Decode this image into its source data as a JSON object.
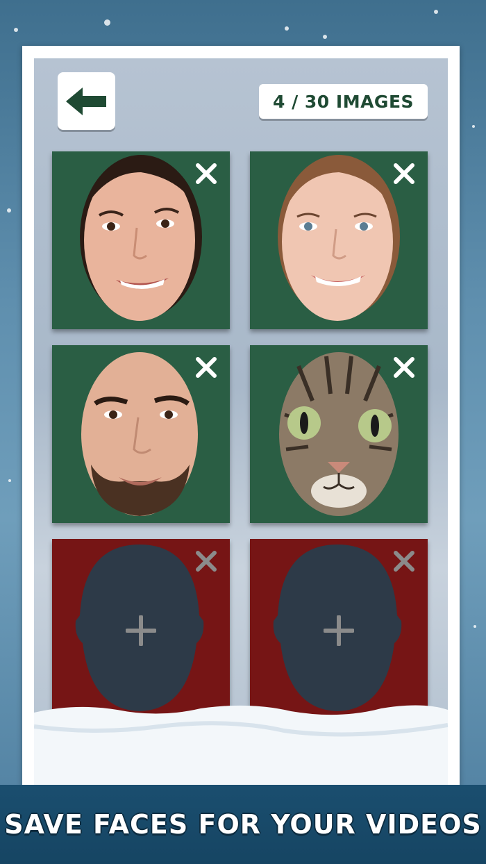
{
  "header": {
    "back_icon": "arrow-left-icon",
    "counter_text": "4 / 30 IMAGES"
  },
  "faces": [
    {
      "state": "filled",
      "kind": "woman-dark-hair",
      "icon": "close-icon"
    },
    {
      "state": "filled",
      "kind": "woman-auburn-hair",
      "icon": "close-icon"
    },
    {
      "state": "filled",
      "kind": "man-beard",
      "icon": "close-icon"
    },
    {
      "state": "filled",
      "kind": "cat",
      "icon": "close-icon"
    },
    {
      "state": "empty",
      "kind": "placeholder",
      "icon": "close-icon",
      "add_icon": "plus-icon"
    },
    {
      "state": "empty",
      "kind": "placeholder",
      "icon": "close-icon",
      "add_icon": "plus-icon"
    }
  ],
  "banner": {
    "text": "SAVE FACES FOR YOUR VIDEOS"
  },
  "colors": {
    "filled_tile": "#2a5e44",
    "empty_tile": "#761515",
    "counter_text": "#1f4a33",
    "banner_bg": "#1a4e6f"
  }
}
